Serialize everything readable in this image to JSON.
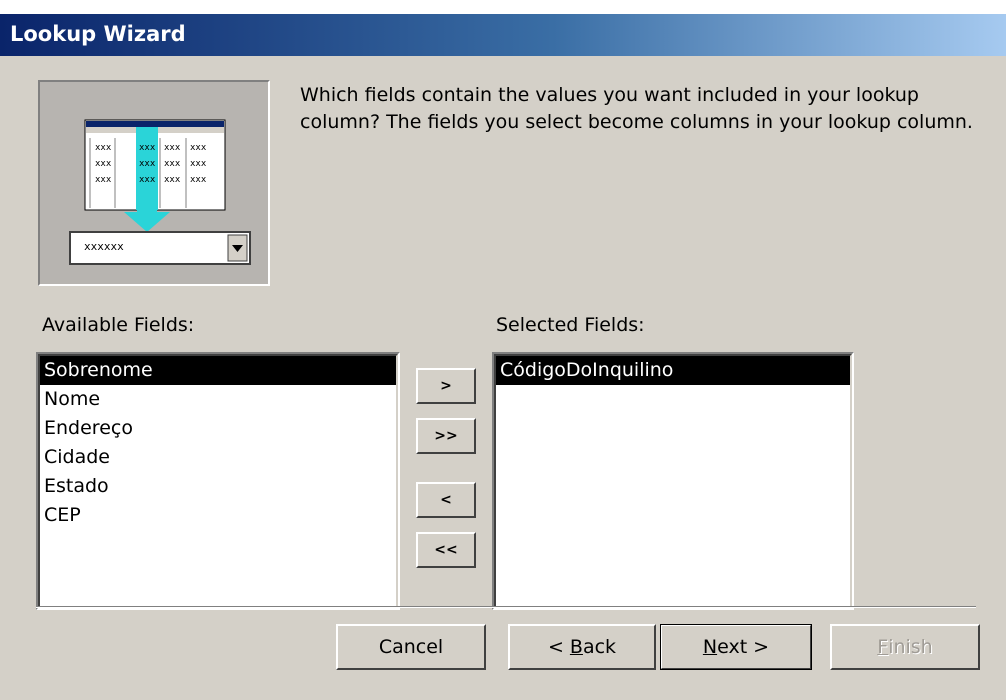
{
  "window": {
    "title": "Lookup Wizard"
  },
  "illustration": {
    "combo_text": "xxxxxx"
  },
  "instructions": "Which fields contain the values you want included in your lookup column? The fields you select become columns in your lookup column.",
  "available": {
    "label": "Available Fields:",
    "items": [
      "Sobrenome",
      "Nome",
      "Endereço",
      "Cidade",
      "Estado",
      "CEP"
    ],
    "selected_index": 0
  },
  "selected": {
    "label": "Selected Fields:",
    "items": [
      "CódigoDoInquilino"
    ],
    "selected_index": 0
  },
  "move_buttons": {
    "add_one": ">",
    "add_all": ">>",
    "remove_one": "<",
    "remove_all": "<<"
  },
  "footer": {
    "cancel": "Cancel",
    "back_prefix": "< ",
    "back_accel": "B",
    "back_rest": "ack",
    "next_accel": "N",
    "next_rest": "ext >",
    "finish_accel": "F",
    "finish_rest": "inish"
  }
}
